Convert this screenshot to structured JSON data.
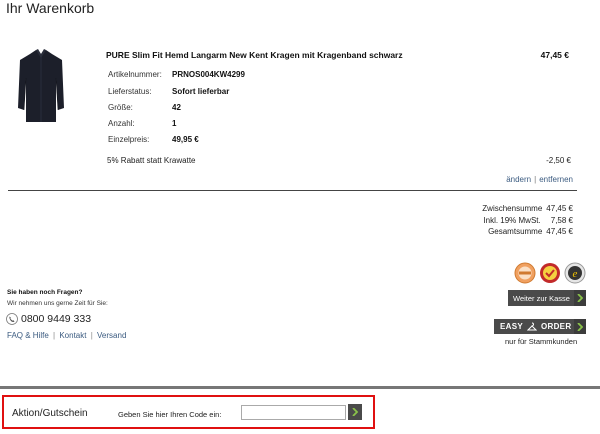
{
  "page": {
    "title": "Ihr Warenkorb"
  },
  "product": {
    "name": "PURE Slim Fit Hemd Langarm New Kent Kragen mit Kragenband schwarz",
    "price": "47,45 €",
    "attributes": [
      {
        "label": "Artikelnummer:",
        "value": "PRNOS004KW4299"
      },
      {
        "label": "Lieferstatus:",
        "value": "Sofort lieferbar"
      },
      {
        "label": "Größe:",
        "value": "42"
      },
      {
        "label": "Anzahl:",
        "value": "1"
      },
      {
        "label": "Einzelpreis:",
        "value": "49,95 €"
      }
    ],
    "discount": {
      "label": "5% Rabatt statt Krawatte",
      "value": "-2,50 €"
    },
    "actions": {
      "edit": "ändern",
      "remove": "entfernen",
      "separator": "|"
    }
  },
  "totals": [
    {
      "label": "Zwischensumme",
      "value": "47,45 €"
    },
    {
      "label": "Inkl. 19% MwSt.",
      "value": "7,58 €"
    },
    {
      "label": "Gesamtsumme",
      "value": "47,45 €"
    }
  ],
  "help": {
    "title": "Sie haben noch Fragen?",
    "text": "Wir nehmen uns gerne Zeit für Sie:",
    "phone": "0800 9449 333",
    "links": [
      "FAQ & Hilfe",
      "Kontakt",
      "Versand"
    ],
    "separator": "|"
  },
  "checkout": {
    "button_label": "Weiter zur Kasse",
    "easy_word": "EASY",
    "order_word": "ORDER",
    "easy_note": "nur für Stammkunden"
  },
  "voucher": {
    "title": "Aktion/Gutschein",
    "prompt": "Geben Sie hier Ihren Code ein:",
    "input_value": ""
  },
  "colors": {
    "accent_link": "#3b5b80",
    "button_dark": "#4a4a4a",
    "highlight_red": "#e01010"
  }
}
